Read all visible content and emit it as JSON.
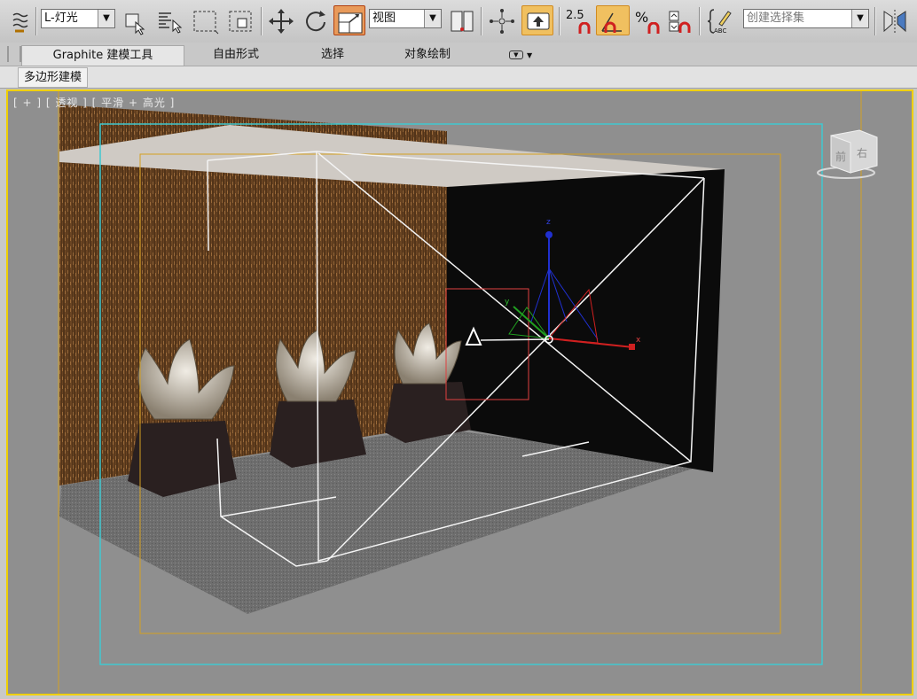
{
  "toolbar": {
    "layer_dropdown": "L-灯光",
    "view_dropdown": "视图",
    "snap_value": "2.5",
    "percent_symbol": "%",
    "selection_set_dropdown": "创建选择集",
    "abc_label": "ABC"
  },
  "ribbon": {
    "tabs": [
      "Graphite 建模工具",
      "自由形式",
      "选择",
      "对象绘制"
    ],
    "panel_label": "多边形建模"
  },
  "viewport": {
    "label": "[ + ] [ 透视 ] [ 平滑 + 高光 ]",
    "viewcube_front": "前",
    "viewcube_right": "右",
    "gizmo_x": "x",
    "gizmo_y": "y",
    "gizmo_z": "z"
  },
  "colors": {
    "active_border": "#f0d000",
    "safe_frame_outer": "#40c8d0",
    "safe_frame_inner": "#d4a020",
    "selection_box": "#e04040"
  }
}
